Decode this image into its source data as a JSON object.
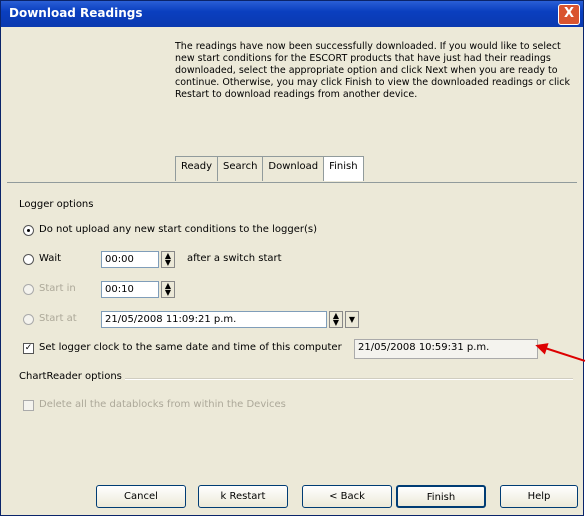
{
  "window": {
    "title": "Download Readings",
    "close_label": "X"
  },
  "description": "The readings have now been successfully downloaded. If you would like to select new start conditions for the ESCORT products that have just had their readings downloaded, select the appropriate option and click Next when you are ready to continue. Otherwise, you may click Finish to view the downloaded readings or click Restart to download readings from another device.",
  "tabs": [
    "Ready",
    "Search",
    "Download",
    "Finish"
  ],
  "logger_options": {
    "title": "Logger options",
    "no_upload_label": "Do not upload any new start conditions to the logger(s)",
    "wait_label": "Wait",
    "wait_value": "00:00",
    "after_switch_label": "after a switch start",
    "start_in_label": "Start in",
    "start_in_value": "00:10",
    "start_at_label": "Start at",
    "start_at_value": "21/05/2008 11:09:21 p.m.",
    "set_clock_label": "Set logger clock to the same date and time of this computer",
    "clock_value": "21/05/2008 10:59:31 p.m."
  },
  "chartreader_options": {
    "title": "ChartReader options",
    "delete_label": "Delete all the datablocks from within the Devices"
  },
  "buttons": {
    "cancel": "Cancel",
    "restart": "k Restart",
    "back": "< Back",
    "finish": "Finish",
    "help": "Help"
  },
  "colors": {
    "titlebar": "#0a3fbf",
    "annotation_arrow": "#dd0000"
  }
}
